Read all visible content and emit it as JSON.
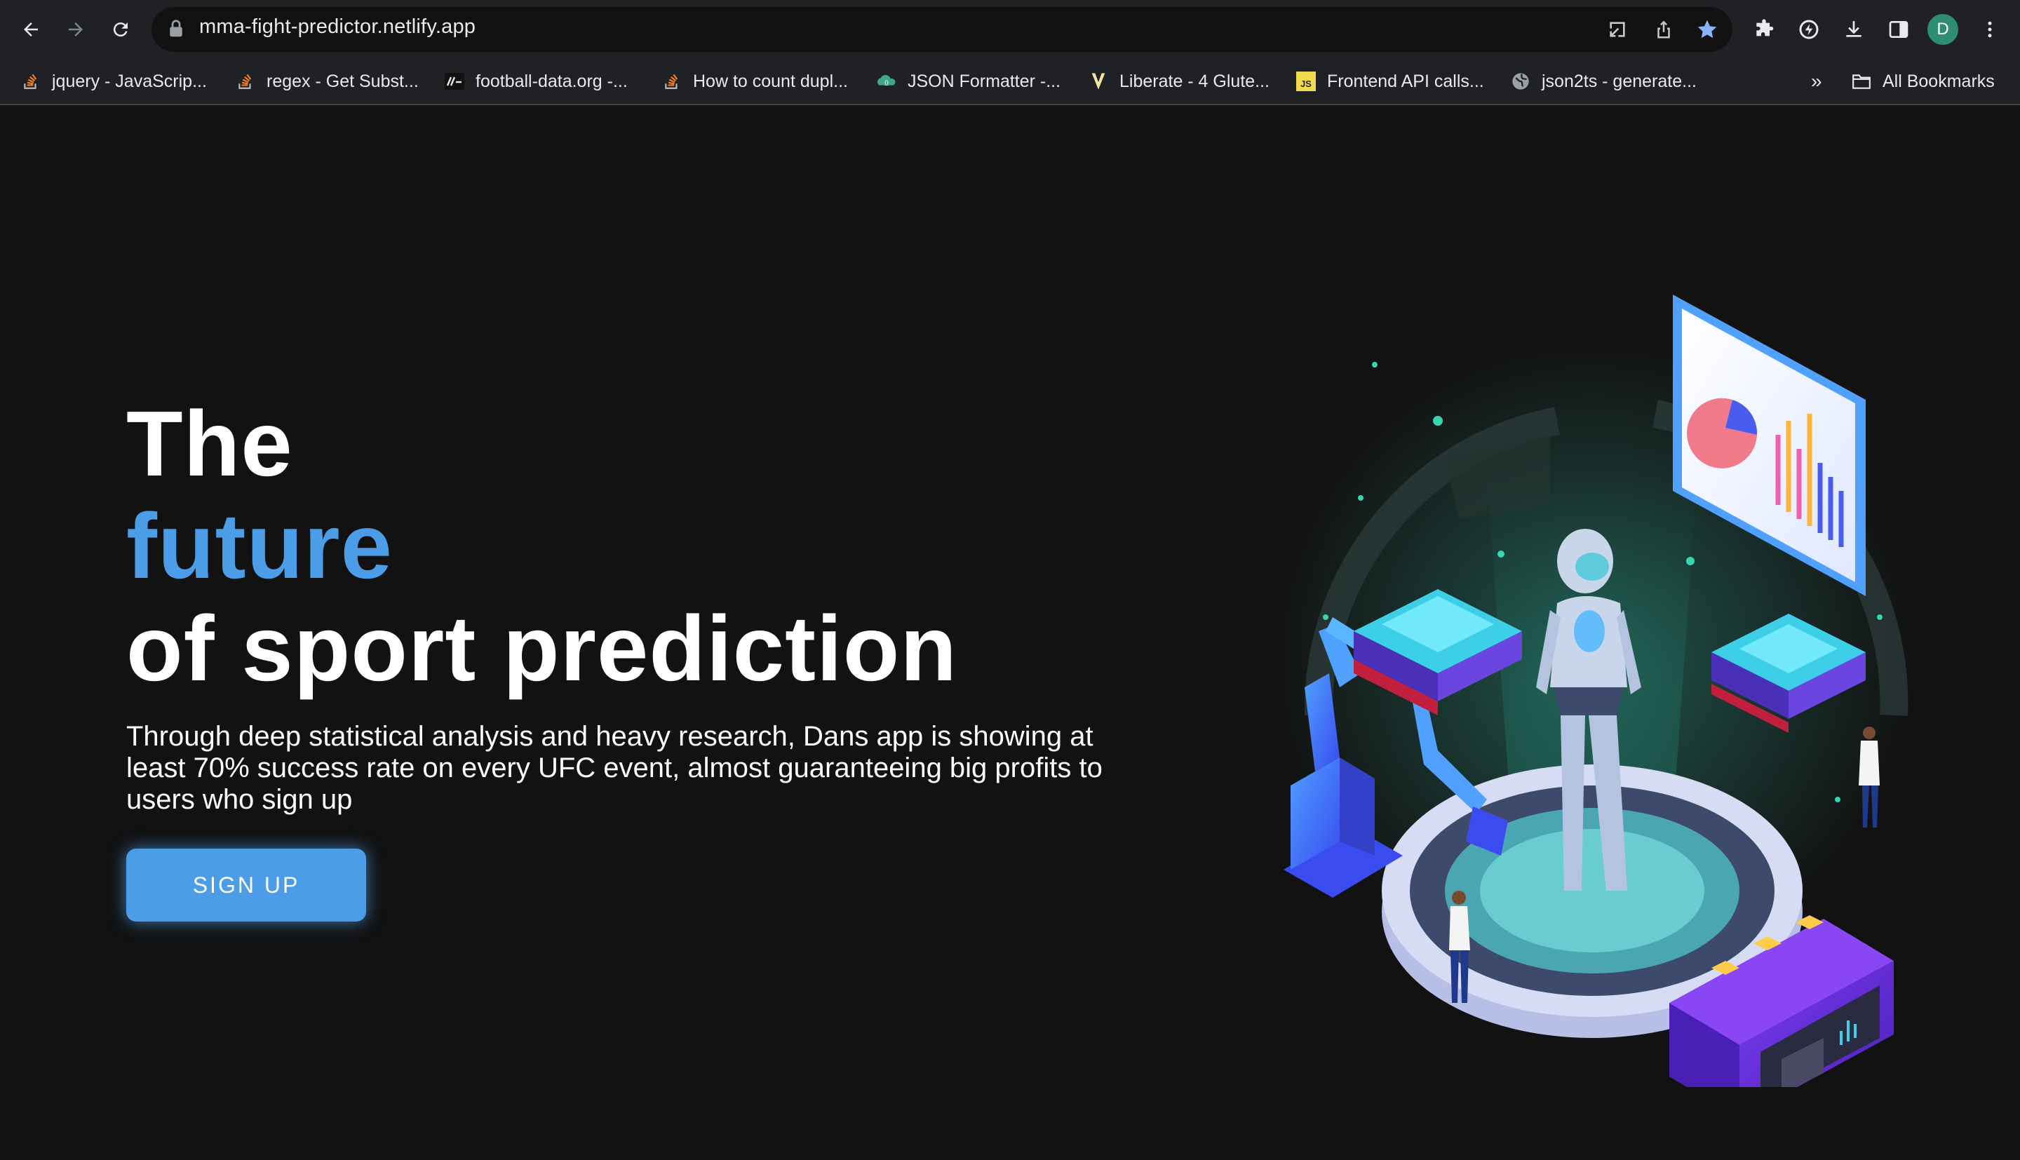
{
  "browser": {
    "url": "mma-fight-predictor.netlify.app",
    "profile_initial": "D",
    "bookmarks": [
      {
        "label": "jquery - JavaScrip...",
        "icon": "stackoverflow-icon"
      },
      {
        "label": "regex - Get Subst...",
        "icon": "stackoverflow-icon"
      },
      {
        "label": "football-data.org -...",
        "icon": "football-data-icon"
      },
      {
        "label": "How to count dupl...",
        "icon": "stackoverflow-icon"
      },
      {
        "label": "JSON Formatter -...",
        "icon": "json-formatter-icon"
      },
      {
        "label": "Liberate - 4 Glute...",
        "icon": "liberate-icon"
      },
      {
        "label": "Frontend API calls...",
        "icon": "js-icon"
      },
      {
        "label": "json2ts - generate...",
        "icon": "globe-icon"
      }
    ],
    "overflow_label": "»",
    "all_bookmarks_label": "All Bookmarks"
  },
  "hero": {
    "title_line1": "The",
    "title_line2": "future",
    "title_line3": "of sport prediction",
    "description": "Through deep statistical analysis and heavy research, Dans app is showing at least 70% success rate on every UFC event, almost guaranteeing big profits to users who sign up",
    "signup_label": "SIGN UP",
    "accent_color": "#4a9de6"
  }
}
